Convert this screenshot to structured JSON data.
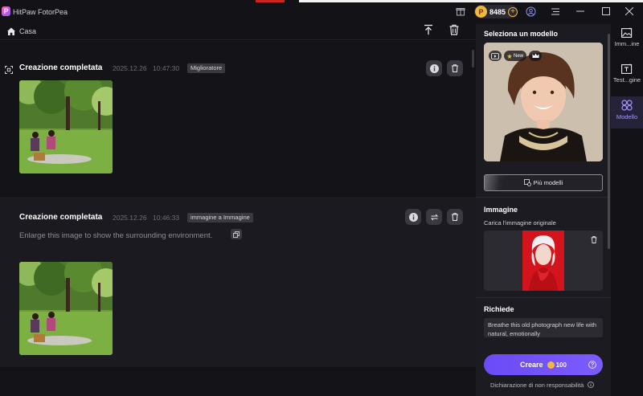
{
  "app": {
    "title": "HitPaw FotorPea",
    "logo_letter": "P"
  },
  "titlebar": {
    "coins": "8485",
    "coin_letter": "P",
    "plus": "+",
    "icons": [
      "gift-icon",
      "user-icon",
      "menu-icon",
      "minimize-icon",
      "maximize-icon",
      "close-icon"
    ]
  },
  "breadcrumb": {
    "home": "Casa"
  },
  "feed": {
    "cards": [
      {
        "title": "Creazione completata",
        "date": "2025.12.26",
        "time": "10:47:30",
        "tag": "Miglioratore"
      },
      {
        "title": "Creazione completata",
        "date": "2025.12.26",
        "time": "10:46:33",
        "tag": "immagine a Immagine",
        "prompt": "Enlarge this image to show the surrounding environment."
      }
    ]
  },
  "panel": {
    "model_heading": "Seleziona un modello",
    "new_badge": "New",
    "more_models": "Più modelli",
    "image_heading": "Immagine",
    "upload_label": "Carica l'immagine originale",
    "request_heading": "Richiede",
    "prompt_text": "Breathe this old photograph new life with natural, emotionally",
    "create_label": "Creare",
    "create_cost": "100",
    "disclaimer": "Dichiarazione di non responsabilità"
  },
  "rail": {
    "items": [
      {
        "label": "Imm...ine",
        "icon": "image-icon",
        "active": false
      },
      {
        "label": "Test...gine",
        "icon": "text-image-icon",
        "active": false
      },
      {
        "label": "Modello",
        "icon": "model-icon",
        "active": true
      }
    ]
  },
  "colors": {
    "accent": "#7c5cff",
    "coin": "#f3b93c",
    "panel_bg": "#1c1b21",
    "feed_bg": "#0f0e13"
  }
}
